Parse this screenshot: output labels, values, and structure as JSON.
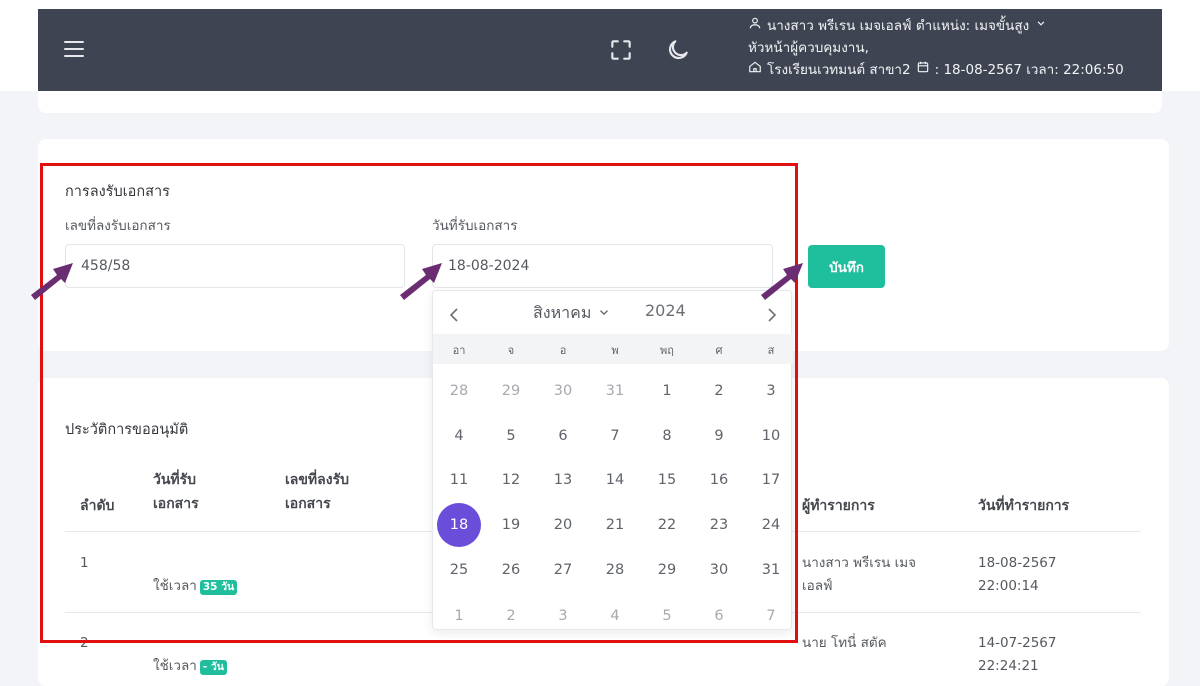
{
  "topbar": {
    "user_line1": "นางสาว พรีเรน เมจเอลฟ์ ตำแหน่ง: เมจขั้นสูง",
    "user_line2": "หัวหน้าผู้ควบคุมงาน,",
    "user_line3": "โรงเรียนเวทมนต์ สาขา2",
    "datetime": ": 18-08-2567 เวลา: 22:06:50"
  },
  "form": {
    "title": "การลงรับเอกสาร",
    "doc_number_label": "เลขที่ลงรับเอกสาร",
    "doc_number_value": "458/58",
    "receive_date_label": "วันที่รับเอกสาร",
    "receive_date_value": "18-08-2024",
    "save_label": "บันทึก"
  },
  "calendar": {
    "month": "สิงหาคม",
    "year": "2024",
    "weekdays": [
      "อา",
      "จ",
      "อ",
      "พ",
      "พฤ",
      "ศ",
      "ส"
    ],
    "weeks": [
      [
        "28",
        "29",
        "30",
        "31",
        "1",
        "2",
        "3"
      ],
      [
        "4",
        "5",
        "6",
        "7",
        "8",
        "9",
        "10"
      ],
      [
        "11",
        "12",
        "13",
        "14",
        "15",
        "16",
        "17"
      ],
      [
        "18",
        "19",
        "20",
        "21",
        "22",
        "23",
        "24"
      ],
      [
        "25",
        "26",
        "27",
        "28",
        "29",
        "30",
        "31"
      ],
      [
        "1",
        "2",
        "3",
        "4",
        "5",
        "6",
        "7"
      ]
    ],
    "selected": "18"
  },
  "history": {
    "title": "ประวัติการขออนุมัติ",
    "col_index": "ลำดับ",
    "col_receive_date_1": "วันที่รับ",
    "col_receive_date_2": "เอกสาร",
    "col_doc_number_1": "เลขที่ลงรับ",
    "col_doc_number_2": "เอกสาร",
    "col_operator": "ผู้ทำรายการ",
    "col_action_date": "วันที่ทำรายการ",
    "rows": [
      {
        "index": "1",
        "time_used_label": "ใช้เวลา",
        "time_used_badge": "35 วัน",
        "operator_1": "นางสาว พรีเรน เมจ",
        "operator_2": "เอลฟ์",
        "action_date": "18-08-2567",
        "action_time": "22:00:14"
      },
      {
        "index": "2",
        "time_used_label": "ใช้เวลา",
        "time_used_badge": "- วัน",
        "operator_1": "นาย โทนี่ สตัค",
        "action_date": "14-07-2567",
        "action_time": "22:24:21"
      }
    ]
  },
  "colors": {
    "topbar": "#3e4451",
    "accent": "#1fbf9e",
    "selected_day": "#6a4ed9",
    "highlight": "#e01010",
    "arrow": "#6b2d72"
  },
  "icons": [
    "menu-icon",
    "fullscreen-icon",
    "moon-icon",
    "user-icon",
    "chevron-down-icon",
    "home-icon",
    "calendar-icon",
    "chevron-left-icon",
    "chevron-right-icon",
    "pointer-arrow"
  ]
}
